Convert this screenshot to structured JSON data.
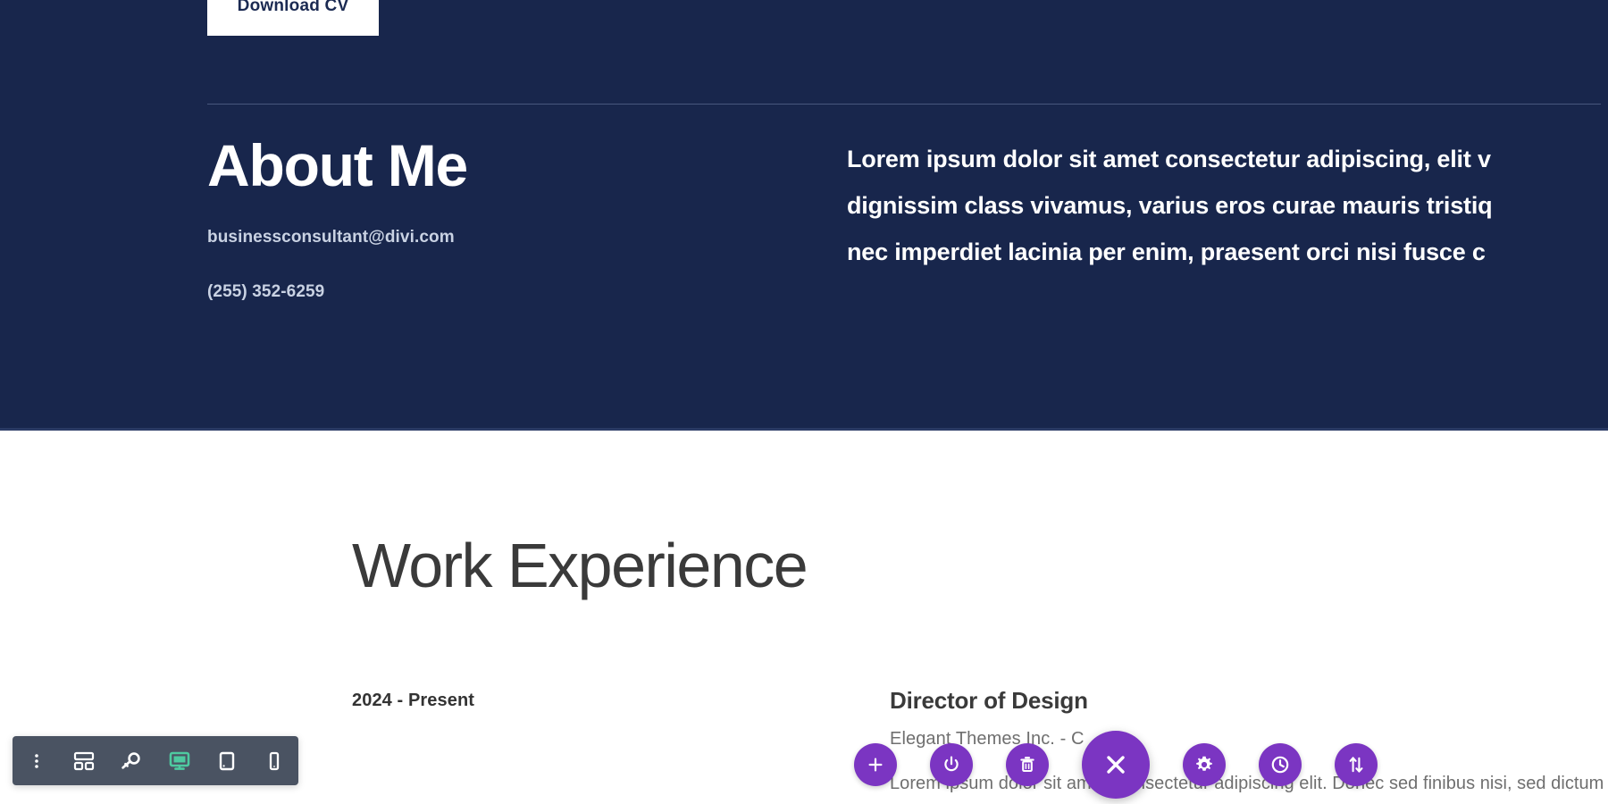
{
  "page": {
    "navy_background": "#18264c",
    "accent_purple": "#7b35c2",
    "toolbar_background": "#4a5362",
    "active_icon_green": "#4ecaa0"
  },
  "hero": {
    "download_cv_label": "Download CV"
  },
  "about": {
    "heading": "About Me",
    "email": "businessconsultant@divi.com",
    "phone": "(255) 352-6259",
    "paragraph_lines": [
      "Lorem ipsum dolor sit amet consectetur adipiscing, elit v",
      "dignissim class vivamus, varius eros curae mauris tristiq",
      "nec imperdiet lacinia per enim, praesent orci nisi fusce c"
    ]
  },
  "work_experience": {
    "heading": "Work Experience",
    "entries": [
      {
        "date": "2024 - Present",
        "role": "Director of Design",
        "company": "Elegant Themes Inc. - C",
        "description": "Lorem ipsum dolor sit amet, consectetur adipiscing elit. Donec sed finibus nisi, sed dictum"
      }
    ]
  },
  "responsive_toolbar": {
    "items": [
      {
        "name": "more-options-icon",
        "label": "More options",
        "active": false
      },
      {
        "name": "wireframe-icon",
        "label": "Wireframe view",
        "active": false
      },
      {
        "name": "zoom-key-icon",
        "label": "Zoom",
        "active": false
      },
      {
        "name": "desktop-icon",
        "label": "Desktop view",
        "active": true
      },
      {
        "name": "tablet-icon",
        "label": "Tablet view",
        "active": false
      },
      {
        "name": "mobile-icon",
        "label": "Mobile view",
        "active": false
      }
    ]
  },
  "action_bar": {
    "items": [
      {
        "name": "add-icon",
        "label": "Add module"
      },
      {
        "name": "power-icon",
        "label": "Toggle builder"
      },
      {
        "name": "trash-icon",
        "label": "Delete"
      },
      {
        "name": "close-icon",
        "label": "Close builder",
        "primary": true
      },
      {
        "name": "gear-icon",
        "label": "Settings"
      },
      {
        "name": "history-icon",
        "label": "Editing history"
      },
      {
        "name": "sort-icon",
        "label": "Sort / reorder"
      }
    ]
  }
}
